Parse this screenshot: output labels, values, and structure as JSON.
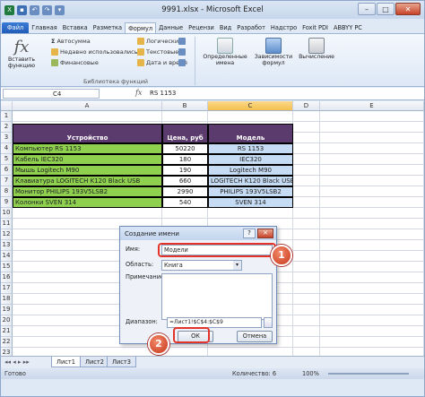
{
  "window": {
    "title": "9991.xlsx - Microsoft Excel"
  },
  "colors": {
    "header_fill": "#5b3a6e",
    "green_fill": "#8fd14f",
    "blue_fill": "#c6dcf4",
    "callout": "#c8361a"
  },
  "ribbon_tabs": [
    "Файл",
    "Главная",
    "Вставка",
    "Разметка",
    "Формул",
    "Данные",
    "Рецензи",
    "Вид",
    "Разработ",
    "Надстро",
    "Foxit PDI",
    "ABBYY PC"
  ],
  "ribbon": {
    "insert_function": "Вставить функцию",
    "autosum": "Автосумма",
    "recent": "Недавно использовались",
    "financial": "Финансовые",
    "logical": "Логические",
    "text": "Текстовые",
    "datetime": "Дата и время",
    "group_library": "Библиотека функций",
    "defined_names": "Определенные имена",
    "dependencies": "Зависимости формул",
    "calculation": "Вычисление"
  },
  "formula_bar": {
    "namebox": "C4",
    "fx": "fx",
    "content": "RS 1153"
  },
  "columns": [
    "A",
    "B",
    "C",
    "D",
    "E"
  ],
  "rows": [
    "1",
    "2",
    "3",
    "4",
    "5",
    "6",
    "7",
    "8",
    "9",
    "10",
    "11",
    "12",
    "13",
    "14",
    "15",
    "16",
    "17",
    "18",
    "19",
    "20",
    "21",
    "22",
    "23"
  ],
  "table": {
    "headers": [
      "Устройство",
      "Цена, руб",
      "Модель"
    ],
    "rows": [
      [
        "Компьютер RS 1153",
        "50220",
        "RS 1153"
      ],
      [
        "Кабель IEC320",
        "180",
        "IEC320"
      ],
      [
        "Мышь Logitech M90",
        "190",
        "Logitech M90"
      ],
      [
        "Клавиатура LOGITECH K120 Black USB",
        "660",
        "LOGITECH K120 Black USB"
      ],
      [
        "Монитор PHILIPS 193V5LSB2",
        "2990",
        "PHILIPS 193V5LSB2"
      ],
      [
        "Колонки SVEN 314",
        "540",
        "SVEN 314"
      ]
    ]
  },
  "sheets": [
    "Лист1",
    "Лист2",
    "Лист3"
  ],
  "status": {
    "ready": "Готово",
    "count": "Количество: 6",
    "zoom": "100%"
  },
  "dialog": {
    "title": "Создание имени",
    "help": "?",
    "name_label": "Имя:",
    "name_value": "Модели",
    "scope_label": "Область:",
    "scope_value": "Книга",
    "comment_label": "Примечание:",
    "range_label": "Диапазон:",
    "range_value": "=Лист1!$C$4:$C$9",
    "ok": "ОК",
    "cancel": "Отмена"
  },
  "callouts": [
    "1",
    "2"
  ]
}
